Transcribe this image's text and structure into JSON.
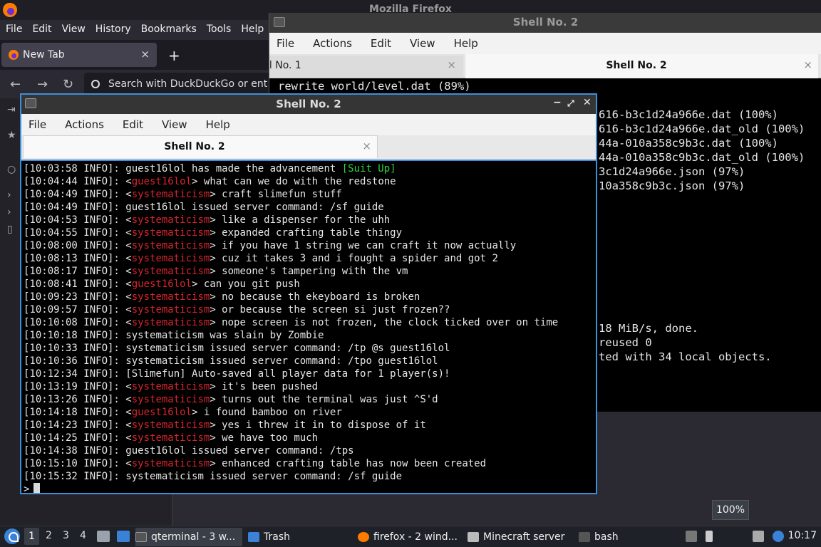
{
  "firefox": {
    "window_title": "Mozilla Firefox",
    "menu": [
      "File",
      "Edit",
      "View",
      "History",
      "Bookmarks",
      "Tools",
      "Help"
    ],
    "tab_label": "New Tab",
    "tab_close": "×",
    "new_tab": "+",
    "back": "←",
    "forward": "→",
    "reload": "↻",
    "search_placeholder": "Search with DuckDuckGo or ent",
    "sidebar_glyphs": [
      "⇥",
      "★",
      "○",
      "›",
      "›",
      "▯"
    ]
  },
  "shell_back": {
    "title": "Shell No. 2",
    "menu": [
      "File",
      "Actions",
      "Edit",
      "View",
      "Help"
    ],
    "tab1_label": "ll No. 1",
    "tab2_label": "Shell No. 2",
    "tab_close": "×",
    "top_line": "rewrite world/level.dat (89%)",
    "right_lines": [
      "616-b3c1d24a966e.dat (100%)",
      "616-b3c1d24a966e.dat_old (100%)",
      "44a-010a358c9b3c.dat (100%)",
      "44a-010a358c9b3c.dat_old (100%)",
      "3c1d24a966e.json (97%)",
      "10a358c9b3c.json (97%)"
    ],
    "right_lines_bottom": [
      "18 MiB/s, done.",
      "reused 0",
      "ted with 34 local objects."
    ]
  },
  "shell_front": {
    "title": "Shell No. 2",
    "minimize": "−",
    "maximize": "⤢",
    "close": "✕",
    "menu": [
      "File",
      "Actions",
      "Edit",
      "View",
      "Help"
    ],
    "tab_label": "Shell No. 2",
    "tab_close": "×",
    "prompt": ">",
    "log": [
      {
        "ts": "[10:03:58 INFO]: ",
        "pre": "guest16lol has made the advancement ",
        "green": "[Suit Up]"
      },
      {
        "ts": "[10:04:44 INFO]: ",
        "user": "guest16lol",
        "msg": "what can we do with the redstone"
      },
      {
        "ts": "[10:04:49 INFO]: ",
        "user": "systematicism",
        "msg": "craft slimefun stuff"
      },
      {
        "ts": "[10:04:49 INFO]: ",
        "text": "guest16lol issued server command: /sf guide"
      },
      {
        "ts": "[10:04:53 INFO]: ",
        "user": "systematicism",
        "msg": "like a dispenser for the uhh"
      },
      {
        "ts": "[10:04:55 INFO]: ",
        "user": "systematicism",
        "msg": "expanded crafting table thingy"
      },
      {
        "ts": "[10:08:00 INFO]: ",
        "user": "systematicism",
        "msg": "if you have 1 string we can craft it now actually"
      },
      {
        "ts": "[10:08:13 INFO]: ",
        "user": "systematicism",
        "msg": "cuz it takes 3 and i fought a spider and got 2"
      },
      {
        "ts": "[10:08:17 INFO]: ",
        "user": "systematicism",
        "msg": "someone's tampering with the vm"
      },
      {
        "ts": "[10:08:41 INFO]: ",
        "user": "guest16lol",
        "msg": "can you git push"
      },
      {
        "ts": "[10:09:23 INFO]: ",
        "user": "systematicism",
        "msg": "no because th ekeyboard is broken"
      },
      {
        "ts": "[10:09:57 INFO]: ",
        "user": "systematicism",
        "msg": "or because the screen si just frozen??"
      },
      {
        "ts": "[10:10:08 INFO]: ",
        "user": "systematicism",
        "msg": "nope screen is not frozen, the clock ticked over on time"
      },
      {
        "ts": "[10:10:18 INFO]: ",
        "text": "systematicism was slain by Zombie"
      },
      {
        "ts": "[10:10:33 INFO]: ",
        "text": "systematicism issued server command: /tp @s guest16lol"
      },
      {
        "ts": "[10:10:36 INFO]: ",
        "text": "systematicism issued server command: /tpo guest16lol"
      },
      {
        "ts": "[10:12:34 INFO]: ",
        "text": "[Slimefun] Auto-saved all player data for 1 player(s)!"
      },
      {
        "ts": "[10:13:19 INFO]: ",
        "user": "systematicism",
        "msg": "it's been pushed"
      },
      {
        "ts": "[10:13:26 INFO]: ",
        "user": "systematicism",
        "msg": "turns out the terminal was just ^S'd"
      },
      {
        "ts": "[10:14:18 INFO]: ",
        "user": "guest16lol",
        "msg": "i found bamboo on river"
      },
      {
        "ts": "[10:14:23 INFO]: ",
        "user": "systematicism",
        "msg": "yes i threw it in to dispose of it"
      },
      {
        "ts": "[10:14:25 INFO]: ",
        "user": "systematicism",
        "msg": "we have too much"
      },
      {
        "ts": "[10:14:38 INFO]: ",
        "text": "guest16lol issued server command: /tps"
      },
      {
        "ts": "[10:15:10 INFO]: ",
        "user": "systematicism",
        "msg": "enhanced crafting table has now been created"
      },
      {
        "ts": "[10:15:32 INFO]: ",
        "text": "systematicism issued server command: /sf guide"
      }
    ]
  },
  "taskbar": {
    "desktops": [
      "1",
      "2",
      "3",
      "4"
    ],
    "tasks": [
      {
        "label": "qterminal - 3 w...",
        "color": "#444"
      },
      {
        "label": "Trash",
        "color": "#3b82d6"
      },
      {
        "label": "firefox - 2 wind...",
        "color": "#ff7b00"
      },
      {
        "label": "Minecraft server",
        "color": "#bbb"
      },
      {
        "label": "bash",
        "color": "#555"
      }
    ],
    "volume": "100%",
    "clock": "10:17"
  },
  "colors": {
    "accent": "#3d8fd9",
    "username_red": "#d8242d",
    "advancement_green": "#2fd13c"
  }
}
